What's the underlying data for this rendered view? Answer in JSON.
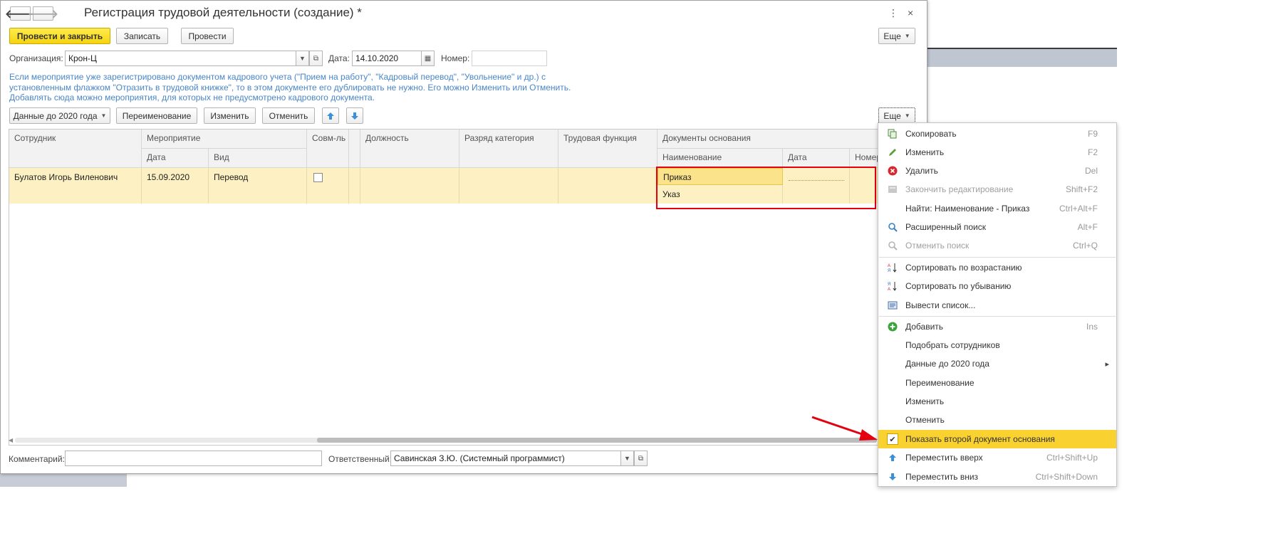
{
  "window": {
    "title": "Регистрация трудовой деятельности (создание) *",
    "nav_back": "🡐",
    "nav_forward": "🡒",
    "menu_icon": "⋮",
    "close_icon": "×"
  },
  "toolbar": {
    "post_close": "Провести и закрыть",
    "save": "Записать",
    "post": "Провести",
    "more": "Еще"
  },
  "header": {
    "org_label": "Организация:",
    "org_value": "Крон-Ц",
    "date_label": "Дата:",
    "date_value": "14.10.2020",
    "number_label": "Номер:",
    "number_value": ""
  },
  "info_text": "Если мероприятие уже зарегистрировано документом кадрового учета (\"Прием на работу\", \"Кадровый перевод\", \"Увольнение\" и др.) с установленным флажком \"Отразить в трудовой книжке\", то в этом документе его дублировать не нужно. Его можно Изменить или Отменить. Добавлять сюда можно мероприятия, для которых не предусмотрено кадрового документа.",
  "table_toolbar": {
    "data_before_2020": "Данные до 2020 года",
    "rename": "Переименование",
    "change": "Изменить",
    "cancel": "Отменить",
    "move_up_icon": "arrow-up-icon",
    "move_down_icon": "arrow-down-icon",
    "more": "Еще"
  },
  "table": {
    "headers": {
      "employee": "Сотрудник",
      "event": "Мероприятие",
      "event_date": "Дата",
      "event_kind": "Вид",
      "combined": "Совм-ль",
      "position": "Должность",
      "rank": "Разряд категория",
      "labor_function": "Трудовая функция",
      "basis_docs": "Документы основания",
      "doc_name": "Наименование",
      "doc_date": "Дата",
      "doc_number": "Номер"
    },
    "rows": [
      {
        "employee": "Булатов Игорь Виленович",
        "date": "15.09.2020",
        "kind": "Перевод",
        "combined": false,
        "position": "",
        "rank": "",
        "labor_function": "",
        "doc1_name": "Приказ",
        "doc2_name": "Указ"
      }
    ]
  },
  "footer": {
    "comment_label": "Комментарий:",
    "comment_value": "",
    "responsible_label": "Ответственный:",
    "responsible_value": "Савинская З.Ю. (Системный программист)"
  },
  "context_menu": {
    "items": [
      {
        "label": "Скопировать",
        "shortcut": "F9",
        "icon": "copy-icon"
      },
      {
        "label": "Изменить",
        "shortcut": "F2",
        "icon": "pencil-icon"
      },
      {
        "label": "Удалить",
        "shortcut": "Del",
        "icon": "delete-icon"
      },
      {
        "label": "Закончить редактирование",
        "shortcut": "Shift+F2",
        "icon": "end-edit-icon"
      },
      {
        "label": "Найти: Наименование - Приказ",
        "shortcut": "Ctrl+Alt+F"
      },
      {
        "label": "Расширенный поиск",
        "shortcut": "Alt+F",
        "icon": "search-icon"
      },
      {
        "label": "Отменить поиск",
        "shortcut": "Ctrl+Q",
        "icon": "cancel-search-icon"
      },
      {
        "label": "Сортировать по возрастанию",
        "icon": "sort-asc-icon"
      },
      {
        "label": "Сортировать по убыванию",
        "icon": "sort-desc-icon"
      },
      {
        "label": "Вывести список...",
        "icon": "print-list-icon"
      },
      {
        "label": "Добавить",
        "shortcut": "Ins",
        "icon": "add-icon"
      },
      {
        "label": "Подобрать сотрудников"
      },
      {
        "label": "Данные до 2020 года",
        "submenu": "▸"
      },
      {
        "label": "Переименование"
      },
      {
        "label": "Изменить"
      },
      {
        "label": "Отменить"
      },
      {
        "label": "Показать второй документ основания",
        "checked": true
      },
      {
        "label": "Переместить вверх",
        "shortcut": "Ctrl+Shift+Up",
        "icon": "arrow-up-icon"
      },
      {
        "label": "Переместить вниз",
        "shortcut": "Ctrl+Shift+Down",
        "icon": "arrow-down-icon"
      }
    ]
  },
  "colors": {
    "accent_yellow": "#f5d30f",
    "highlight_red": "#e3000f",
    "row_bg": "#fdf1c3",
    "info_blue": "#4a86c8"
  }
}
